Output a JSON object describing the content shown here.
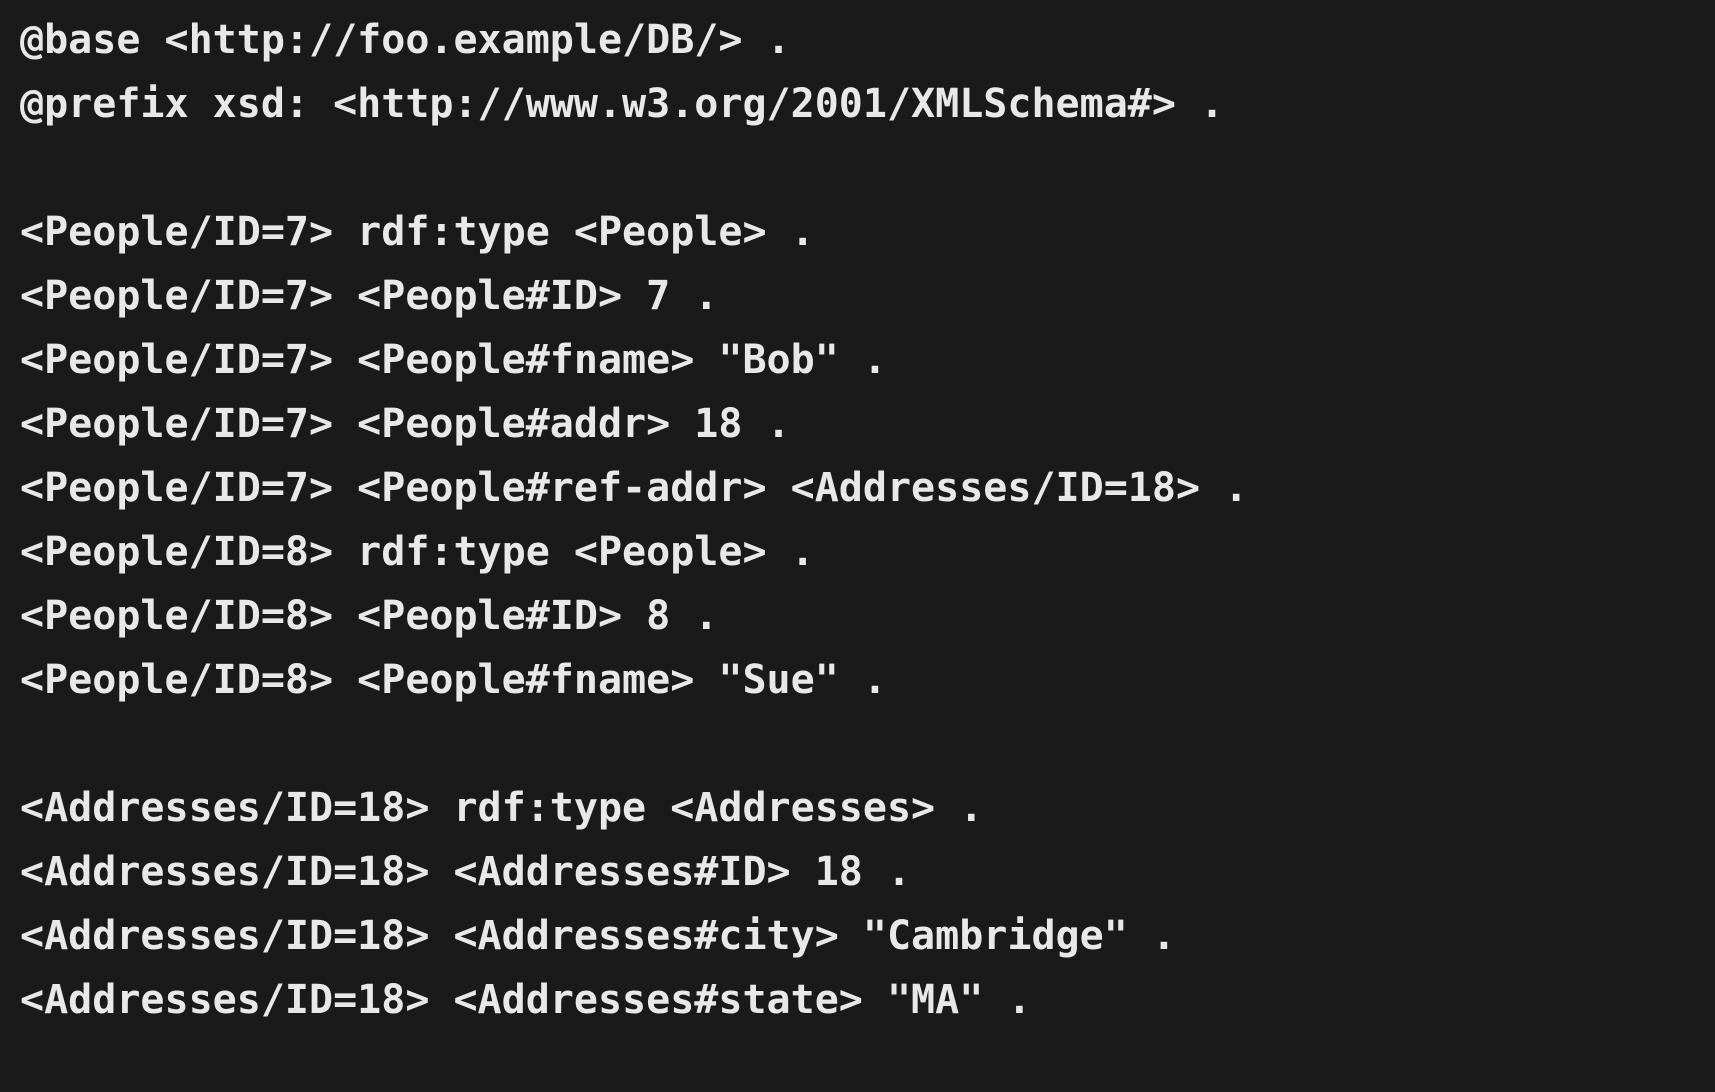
{
  "code": {
    "lines": [
      "@base <http://foo.example/DB/> .",
      "@prefix xsd: <http://www.w3.org/2001/XMLSchema#> .",
      "",
      "<People/ID=7> rdf:type <People> .",
      "<People/ID=7> <People#ID> 7 .",
      "<People/ID=7> <People#fname> \"Bob\" .",
      "<People/ID=7> <People#addr> 18 .",
      "<People/ID=7> <People#ref-addr> <Addresses/ID=18> .",
      "<People/ID=8> rdf:type <People> .",
      "<People/ID=8> <People#ID> 8 .",
      "<People/ID=8> <People#fname> \"Sue\" .",
      "",
      "<Addresses/ID=18> rdf:type <Addresses> .",
      "<Addresses/ID=18> <Addresses#ID> 18 .",
      "<Addresses/ID=18> <Addresses#city> \"Cambridge\" .",
      "<Addresses/ID=18> <Addresses#state> \"MA\" ."
    ]
  }
}
